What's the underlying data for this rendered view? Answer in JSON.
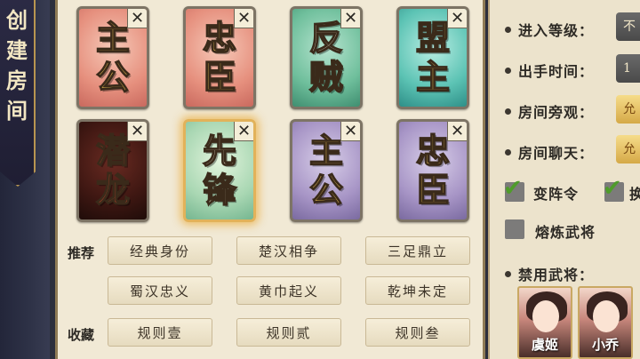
{
  "side": {
    "title": [
      "创",
      "建",
      "房",
      "间"
    ]
  },
  "cards": [
    {
      "l1": "主",
      "l2": "公",
      "close": "✕"
    },
    {
      "l1": "忠",
      "l2": "臣",
      "close": "✕"
    },
    {
      "l1": "反",
      "l2": "贼",
      "close": "✕"
    },
    {
      "l1": "盟",
      "l2": "主",
      "close": "✕"
    },
    {
      "l1": "潜",
      "l2": "龙",
      "close": "✕"
    },
    {
      "l1": "先",
      "l2": "锋",
      "close": "✕"
    },
    {
      "l1": "主",
      "l2": "公",
      "close": "✕"
    },
    {
      "l1": "忠",
      "l2": "臣",
      "close": "✕"
    }
  ],
  "recommend": {
    "label": "推荐",
    "buttons": [
      "经典身份",
      "楚汉相争",
      "三足鼎立",
      "蜀汉忠义",
      "黄巾起义",
      "乾坤未定"
    ]
  },
  "favorites": {
    "label": "收藏",
    "buttons": [
      "规则壹",
      "规则贰",
      "规则叁"
    ]
  },
  "settings": {
    "entry_level": {
      "label": "进入等级：",
      "value": "不"
    },
    "play_time": {
      "label": "出手时间：",
      "value": "1"
    },
    "spectate": {
      "label": "房间旁观：",
      "value": "允"
    },
    "chat": {
      "label": "房间聊天：",
      "value": "允"
    },
    "formation_change": {
      "label": "变阵令",
      "checked": true
    },
    "second_option": {
      "label": "换",
      "checked": true
    },
    "refine_general": {
      "label": "熔炼武将",
      "checked": false
    },
    "banned_generals": {
      "label": "禁用武将："
    }
  },
  "banned_heroes": [
    {
      "name": "虞姬"
    },
    {
      "name": "小乔"
    }
  ]
}
